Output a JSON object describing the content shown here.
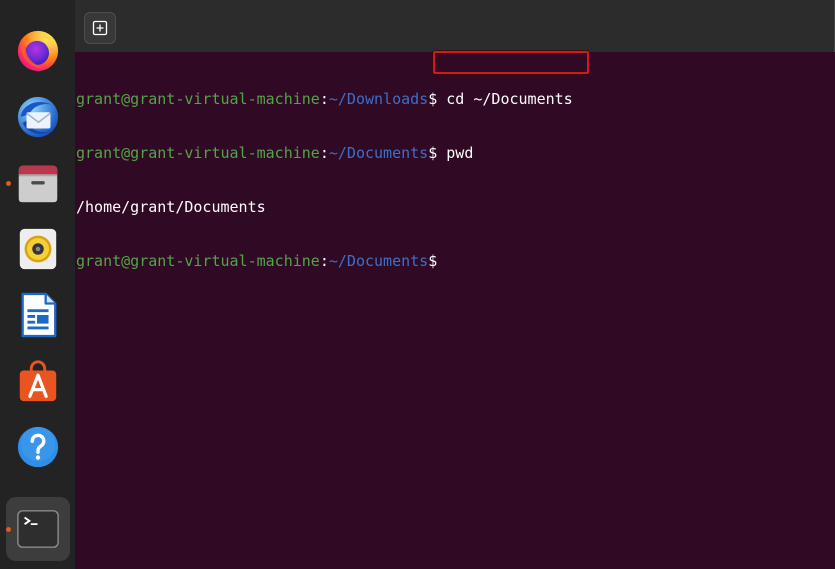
{
  "dock": {
    "running_indicator_color": "#e95420",
    "items": [
      {
        "icon": "firefox-icon",
        "running": false,
        "active": false
      },
      {
        "icon": "thunderbird-icon",
        "running": false,
        "active": false
      },
      {
        "icon": "files-icon",
        "running": true,
        "active": false
      },
      {
        "icon": "rhythmbox-icon",
        "running": false,
        "active": false
      },
      {
        "icon": "libreoffice-writer-icon",
        "running": false,
        "active": false
      },
      {
        "icon": "app-center-icon",
        "running": false,
        "active": false
      },
      {
        "icon": "help-icon",
        "running": false,
        "active": false
      },
      {
        "icon": "terminal-icon",
        "running": true,
        "active": true
      }
    ]
  },
  "header": {
    "new_tab_icon": "new-tab-icon"
  },
  "terminal": {
    "colors": {
      "background": "#300a24",
      "text": "#ffffff",
      "user": "#52a447",
      "path": "#3c6fc8"
    },
    "lines": [
      {
        "user": "grant@grant-virtual-machine",
        "separator": ":",
        "path": "~/Downloads",
        "symbol": "$",
        "command": "cd ~/Documents"
      },
      {
        "user": "grant@grant-virtual-machine",
        "separator": ":",
        "path": "~/Documents",
        "symbol": "$",
        "command": "pwd"
      },
      {
        "output": "/home/grant/Documents"
      },
      {
        "user": "grant@grant-virtual-machine",
        "separator": ":",
        "path": "~/Documents",
        "symbol": "$",
        "command": ""
      }
    ]
  },
  "annotation": {
    "color": "#d01a1f"
  }
}
